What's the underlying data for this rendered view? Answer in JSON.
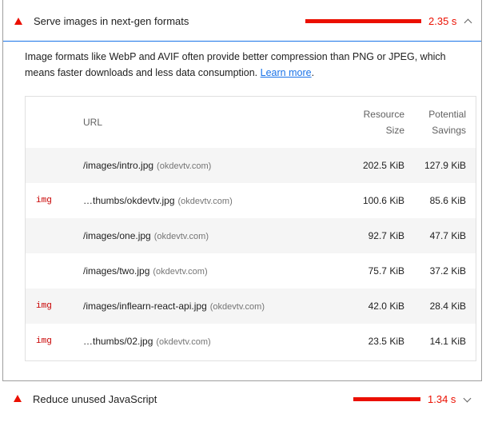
{
  "opportunity": {
    "title": "Serve images in next-gen formats",
    "savings": "2.35 s",
    "description": "Image formats like WebP and AVIF often provide better compression than PNG or JPEG, which means faster downloads and less data consumption.",
    "learn_more": "Learn more",
    "period": ".",
    "table": {
      "col_url": "URL",
      "col_size_line1": "Resource",
      "col_size_line2": "Size",
      "col_savings_line1": "Potential",
      "col_savings_line2": "Savings",
      "rows": [
        {
          "tag": "",
          "url": "/images/intro.jpg",
          "host": "(okdevtv.com)",
          "size": "202.5 KiB",
          "savings": "127.9 KiB"
        },
        {
          "tag": "img",
          "url": "…thumbs/okdevtv.jpg",
          "host": "(okdevtv.com)",
          "size": "100.6 KiB",
          "savings": "85.6 KiB"
        },
        {
          "tag": "",
          "url": "/images/one.jpg",
          "host": "(okdevtv.com)",
          "size": "92.7 KiB",
          "savings": "47.7 KiB"
        },
        {
          "tag": "",
          "url": "/images/two.jpg",
          "host": "(okdevtv.com)",
          "size": "75.7 KiB",
          "savings": "37.2 KiB"
        },
        {
          "tag": "img",
          "url": "/images/inflearn-react-api.jpg",
          "host": "(okdevtv.com)",
          "size": "42.0 KiB",
          "savings": "28.4 KiB"
        },
        {
          "tag": "img",
          "url": "…thumbs/02.jpg",
          "host": "(okdevtv.com)",
          "size": "23.5 KiB",
          "savings": "14.1 KiB"
        }
      ]
    }
  },
  "next_opportunity": {
    "title": "Reduce unused JavaScript",
    "savings": "1.34 s"
  },
  "colors": {
    "fail_red": "#eb0f00",
    "link_blue": "#1a73e8",
    "row_shade": "#f5f5f5"
  },
  "icons": {
    "fail": "warning-triangle-icon",
    "expanded": "chevron-up-icon",
    "collapsed": "chevron-down-icon"
  }
}
